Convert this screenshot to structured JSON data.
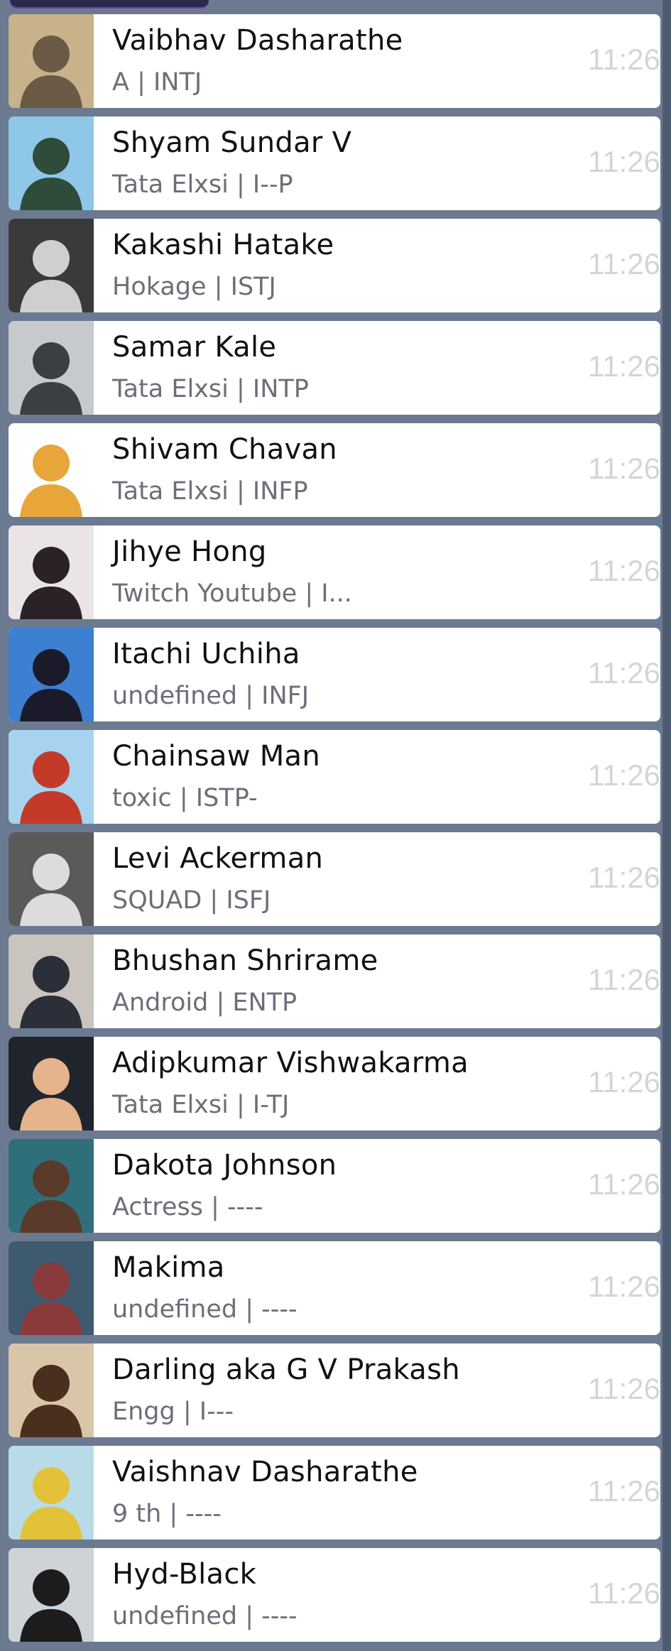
{
  "contacts": [
    {
      "name": "Vaibhav Dasharathe",
      "status": "A | INTJ",
      "time": "11:26",
      "avatar_colors": [
        "#c8b28a",
        "#6b5a45"
      ]
    },
    {
      "name": "Shyam Sundar V",
      "status": "Tata Elxsi | I--P",
      "time": "11:26",
      "avatar_colors": [
        "#8fc7e8",
        "#2f4b3a"
      ]
    },
    {
      "name": "Kakashi Hatake",
      "status": "Hokage | ISTJ",
      "time": "11:26",
      "avatar_colors": [
        "#3a3a3a",
        "#cfcfcf"
      ]
    },
    {
      "name": "Samar Kale",
      "status": "Tata Elxsi | INTP",
      "time": "11:26",
      "avatar_colors": [
        "#c7cacc",
        "#3c3f42"
      ]
    },
    {
      "name": "Shivam Chavan",
      "status": "Tata Elxsi | INFP",
      "time": "11:26",
      "avatar_colors": [
        "#ffffff",
        "#e8a63a"
      ]
    },
    {
      "name": "Jihye Hong",
      "status": "Twitch Youtube | I...",
      "time": "11:26",
      "avatar_colors": [
        "#eae4e6",
        "#2a2226"
      ]
    },
    {
      "name": "Itachi Uchiha",
      "status": "undefined | INFJ",
      "time": "11:26",
      "avatar_colors": [
        "#3d7fd0",
        "#1a1a2a"
      ]
    },
    {
      "name": "Chainsaw Man",
      "status": "toxic | ISTP-",
      "time": "11:26",
      "avatar_colors": [
        "#a7d3ee",
        "#c43a2a"
      ]
    },
    {
      "name": "Levi Ackerman",
      "status": "SQUAD | ISFJ",
      "time": "11:26",
      "avatar_colors": [
        "#5a5a5a",
        "#dcdcdc"
      ]
    },
    {
      "name": "Bhushan Shrirame",
      "status": "Android | ENTP",
      "time": "11:26",
      "avatar_colors": [
        "#c9c4bd",
        "#2b2f3a"
      ]
    },
    {
      "name": "Adipkumar Vishwakarma",
      "status": "Tata Elxsi | I-TJ",
      "time": "11:26",
      "avatar_colors": [
        "#20242c",
        "#e6b48c"
      ]
    },
    {
      "name": "Dakota Johnson",
      "status": "Actress | ----",
      "time": "11:26",
      "avatar_colors": [
        "#2f6f7a",
        "#5a3a2a"
      ]
    },
    {
      "name": "Makima",
      "status": "undefined | ----",
      "time": "11:26",
      "avatar_colors": [
        "#3e5a6e",
        "#8a3a3a"
      ]
    },
    {
      "name": "Darling aka G V Prakash",
      "status": "Engg | I---",
      "time": "11:26",
      "avatar_colors": [
        "#d9c6a8",
        "#4a2e1e"
      ]
    },
    {
      "name": "Vaishnav Dasharathe",
      "status": "9 th | ----",
      "time": "11:26",
      "avatar_colors": [
        "#b9dbe8",
        "#e3c23a"
      ]
    },
    {
      "name": "Hyd-Black",
      "status": "undefined | ----",
      "time": "11:26",
      "avatar_colors": [
        "#cdd3d6",
        "#1c1c1c"
      ]
    }
  ]
}
